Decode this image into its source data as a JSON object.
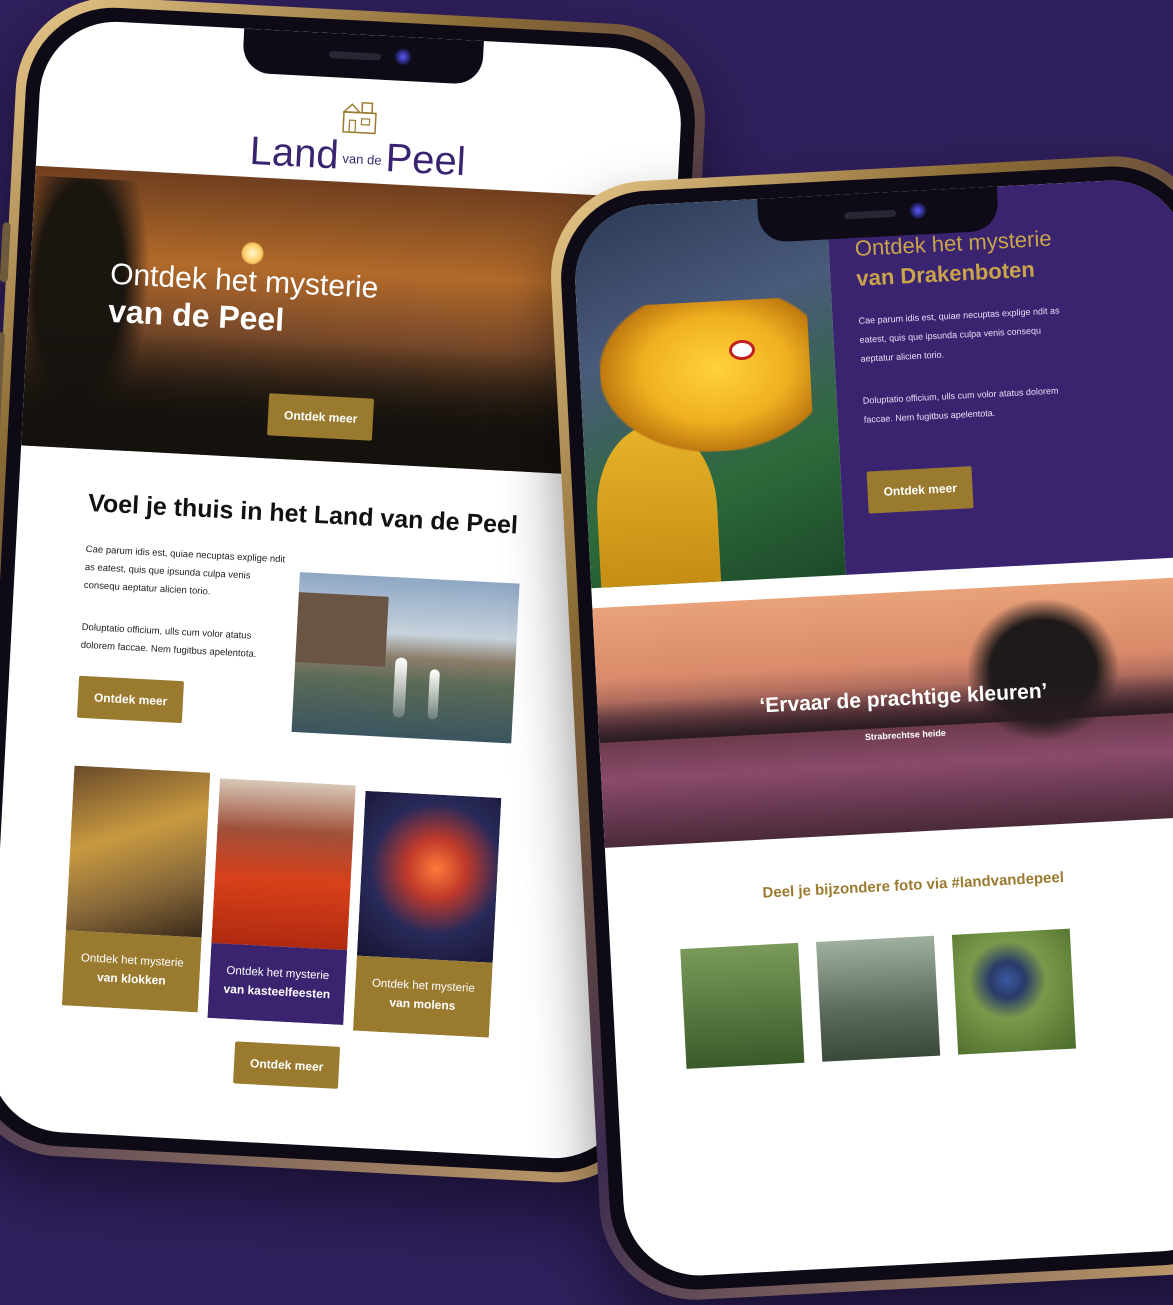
{
  "brand": {
    "logo_word_1": "Land",
    "logo_word_small": "van de",
    "logo_word_2": "Peel",
    "accent_gold": "#9a7a2f",
    "accent_purple": "#3a2470",
    "background": "#2f1f5c"
  },
  "phone_left": {
    "hero": {
      "title_line_1": "Ontdek het mysterie",
      "title_line_2": "van de Peel",
      "button_label": "Ontdek meer"
    },
    "intro": {
      "title": "Voel je thuis in het Land van de Peel",
      "paragraph_1": "Cae parum idis est, quiae necuptas explige ndit as eatest, quis que ipsunda culpa venis consequ aeptatur alicien torio.",
      "paragraph_2": "Doluptatio officium, ulls cum volor atatus dolorem faccae. Nem fugitbus apelentota.",
      "button_label": "Ontdek meer"
    },
    "cards": [
      {
        "line_1": "Ontdek het mysterie",
        "line_2": "van klokken"
      },
      {
        "line_1": "Ontdek het mysterie",
        "line_2": "van kasteelfeesten"
      },
      {
        "line_1": "Ontdek het mysterie",
        "line_2": "van molens"
      }
    ],
    "bottom_button_label": "Ontdek meer"
  },
  "phone_right": {
    "feature": {
      "title_line_1": "Ontdek het mysterie",
      "title_line_2": "van Drakenboten",
      "paragraph_1": "Cae parum idis est, quiae necuptas explige ndit as eatest, quis que ipsunda culpa venis consequ aeptatur alicien torio.",
      "paragraph_2": "Doluptatio officium, ulls cum volor atatus dolorem faccae. Nem fugitbus apelentota.",
      "button_label": "Ontdek meer"
    },
    "banner": {
      "quote": "‘Ervaar de prachtige kleuren’",
      "caption": "Strabrechtse heide"
    },
    "share_title": "Deel je bijzondere foto via #landvandepeel"
  }
}
